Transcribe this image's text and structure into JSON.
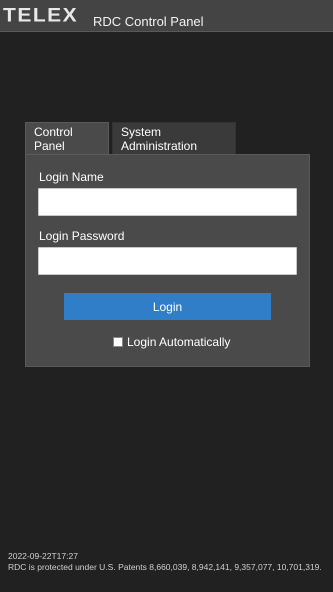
{
  "header": {
    "logo_text": "TELEX",
    "title": "RDC Control Panel"
  },
  "tabs": [
    {
      "label": "Control Panel",
      "active": true
    },
    {
      "label": "System Administration",
      "active": false
    }
  ],
  "login_form": {
    "name_label": "Login Name",
    "name_value": "",
    "password_label": "Login Password",
    "password_value": "",
    "login_button_label": "Login",
    "auto_login_label": "Login Automatically",
    "auto_login_checked": false
  },
  "footer": {
    "timestamp": "2022-09-22T17:27",
    "patent_notice": "RDC is protected under U.S. Patents 8,660,039, 8,942,141, 9,357,077, 10,701,319."
  },
  "colors": {
    "background": "#212121",
    "header": "#444444",
    "panel": "#4a4a4a",
    "accent": "#2f7ec7"
  }
}
